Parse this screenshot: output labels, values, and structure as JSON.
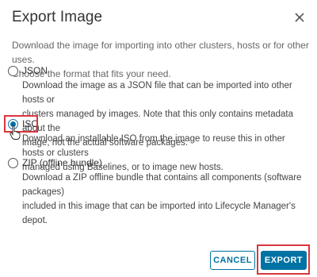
{
  "dialog": {
    "title": "Export Image",
    "close_icon": "close-icon",
    "intro_line1": "Download the image for importing into other clusters, hosts or for other uses.",
    "intro_line2": "Choose the format that fits your need."
  },
  "options": [
    {
      "label": "JSON",
      "checked": false,
      "desc_lines": [
        "Download the image as a JSON file that can be imported into other hosts or",
        "clusters managed by images. Note that this only contains metadata about the",
        "image, not the actual software packages."
      ]
    },
    {
      "label": "ISO",
      "checked": true,
      "desc_lines": [
        "Download an installable ISO from the image to reuse this in other hosts or clusters",
        "managed using Baselines, or to image new hosts."
      ]
    },
    {
      "label": "ZIP (offline bundle)",
      "checked": false,
      "desc_lines": [
        "Download a ZIP offline bundle that contains all components (software packages)",
        "included in this image that can be imported into Lifecycle Manager's depot."
      ]
    }
  ],
  "buttons": {
    "cancel": "CANCEL",
    "export": "EXPORT"
  },
  "colors": {
    "accent": "#0072a3",
    "highlight": "#d9363e"
  }
}
